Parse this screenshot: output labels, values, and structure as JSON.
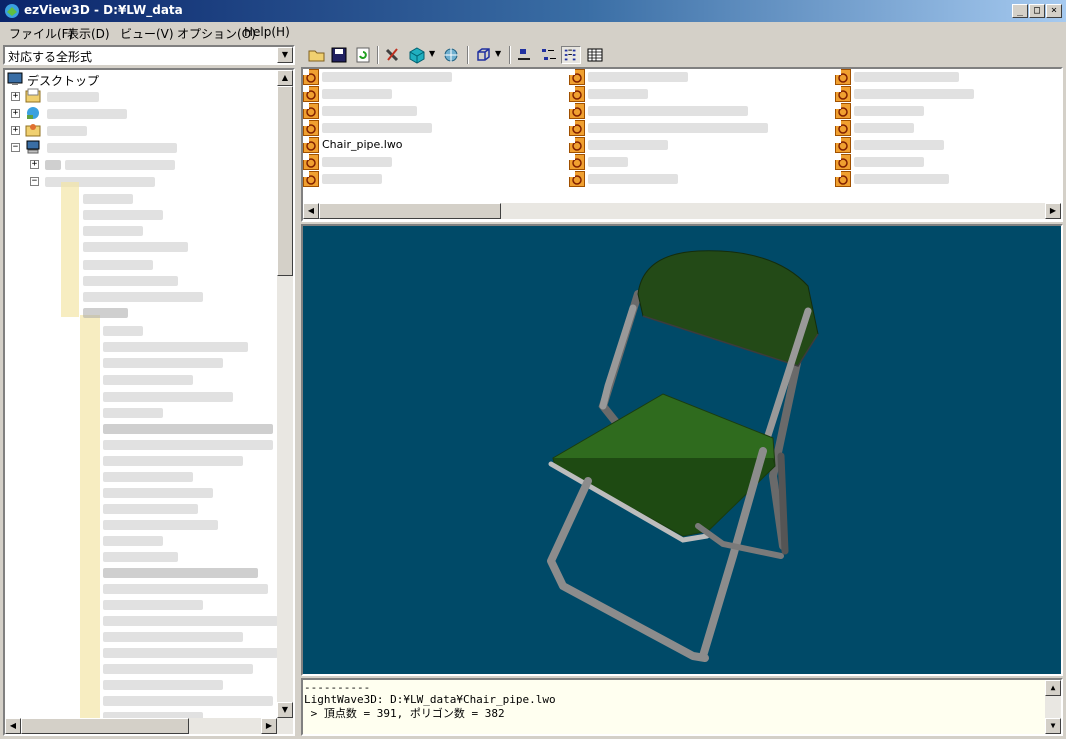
{
  "window": {
    "title": "ezView3D - D:¥LW_data",
    "min_label": "_",
    "max_label": "□",
    "close_label": "×"
  },
  "menubar": {
    "items": [
      "ファイル(F)",
      "表示(D)",
      "ビュー(V)",
      "オプション(O)",
      "Help(H)"
    ]
  },
  "filter": {
    "value": "対応する全形式"
  },
  "tree": {
    "root_label": "デスクトップ"
  },
  "toolbar": {
    "buttons": [
      "open-folder-icon",
      "save-icon",
      "refresh-icon",
      "tools-icon",
      "cube-icon",
      "rotate-icon",
      "box-outline-icon",
      "large-icons-icon",
      "small-icons-icon",
      "list-view-icon",
      "details-view-icon"
    ]
  },
  "filelist": {
    "selected_file": "Chair_pipe.lwo"
  },
  "log": {
    "separator": "----------",
    "line1": "LightWave3D: D:¥LW_data¥Chair_pipe.lwo",
    "line2": " > 頂点数 = 391, ポリゴン数 = 382"
  },
  "colors": {
    "viewport_bg": "#004a68",
    "chair_green": "#2f6b1e",
    "chair_dark_green": "#234a17",
    "pipe_gray": "#8c8c8c"
  }
}
